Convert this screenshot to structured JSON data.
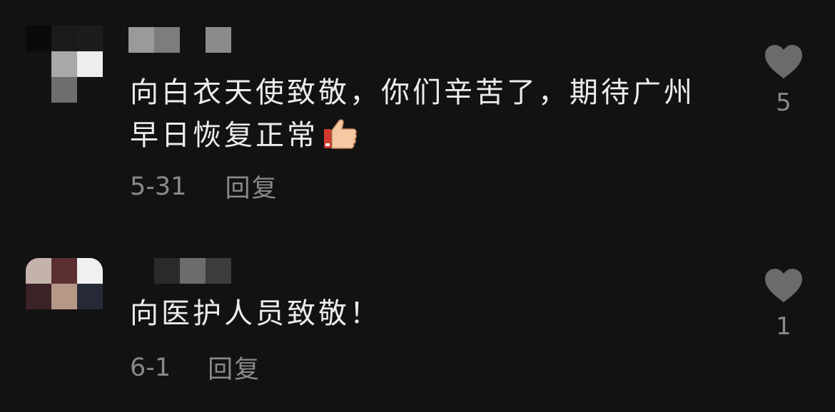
{
  "comments": [
    {
      "text": "向白衣天使致敬，你们辛苦了，期待广州早日恢复正常",
      "date": "5-31",
      "reply_label": "回复",
      "like_count": "5",
      "emoji": "thumbs-up-icon"
    },
    {
      "text": "向医护人员致敬！",
      "date": "6-1",
      "reply_label": "回复",
      "like_count": "1"
    }
  ],
  "colors": {
    "background": "#121212",
    "text": "#ececec",
    "meta": "#8a8a8a",
    "heart": "#6b6b6b"
  }
}
